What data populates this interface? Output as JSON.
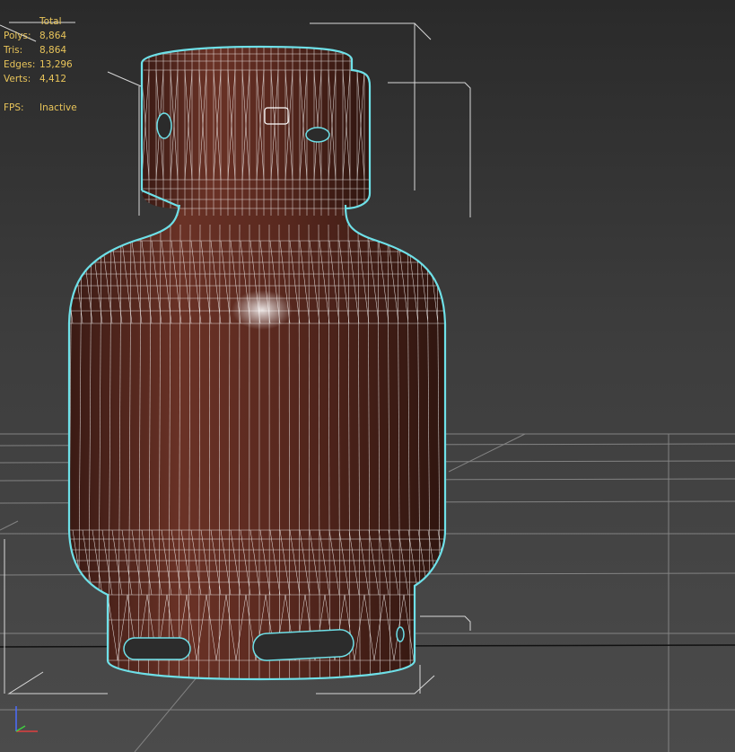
{
  "viewport": {
    "name": "perspective-viewport",
    "background_top": "#2a2a2a",
    "background_bottom": "#4b4b4b",
    "wire_color": "#ffffff",
    "selection_color": "#6ee0e8",
    "bracket_color": "#d8d8d8",
    "material_color": "#5c2a20"
  },
  "stats": {
    "header": "Total",
    "polys_label": "Polys:",
    "polys_value": "8,864",
    "tris_label": "Tris:",
    "tris_value": "8,864",
    "edges_label": "Edges:",
    "edges_value": "13,296",
    "verts_label": "Verts:",
    "verts_value": "4,412",
    "fps_label": "FPS:",
    "fps_value": "Inactive"
  },
  "axis_gizmo": {
    "icon": "xyz-axis-icon"
  }
}
